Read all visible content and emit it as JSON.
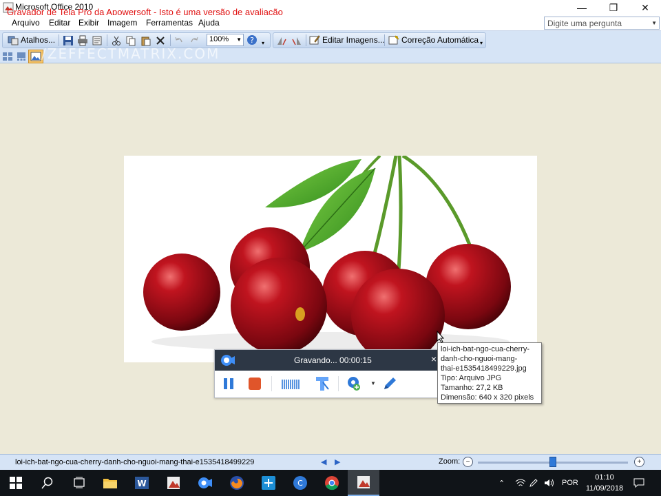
{
  "window": {
    "title": "Microsoft Office 2010",
    "watermark": "Gravador de Tela Pro da Apowersoft - Isto é uma versão de avaliação",
    "controls": {
      "minimize": "—",
      "restore": "❐",
      "close": "✕"
    }
  },
  "menu": {
    "items": [
      "Arquivo",
      "Editar",
      "Exibir",
      "Imagem",
      "Ferramentas",
      "Ajuda"
    ],
    "ask_placeholder": "Digite uma pergunta"
  },
  "toolbar": {
    "shortcuts_label": "Atalhos...",
    "zoom_value": "100%",
    "edit_images_label": "Editar Imagens...",
    "auto_correct_label": "Correção Automática"
  },
  "background_watermark": "/ZEFFECTMATRIX.COM",
  "recorder": {
    "status": "Gravando... 00:00:15",
    "close": "×"
  },
  "tooltip": {
    "lines": [
      "loi-ich-bat-ngo-cua-cherry-",
      "danh-cho-nguoi-mang-",
      "thai-e1535418499229.jpg",
      "Tipo: Arquivo JPG",
      "Tamanho: 27,2 KB",
      "Dimensão: 640 x 320 pixels"
    ]
  },
  "statusbar": {
    "filename": "loi-ich-bat-ngo-cua-cherry-danh-cho-nguoi-mang-thai-e1535418499229",
    "zoom_label": "Zoom:",
    "zoom_minus": "−",
    "zoom_plus": "+",
    "zoom_level": 0.5
  },
  "taskbar": {
    "tray": {
      "language": "POR",
      "time": "01:10",
      "date": "11/09/2018"
    }
  },
  "colors": {
    "watermark": "#e01010",
    "accent": "#2f79d8",
    "recorder_header": "#2d3745",
    "recorder_stop": "#e0552a"
  }
}
